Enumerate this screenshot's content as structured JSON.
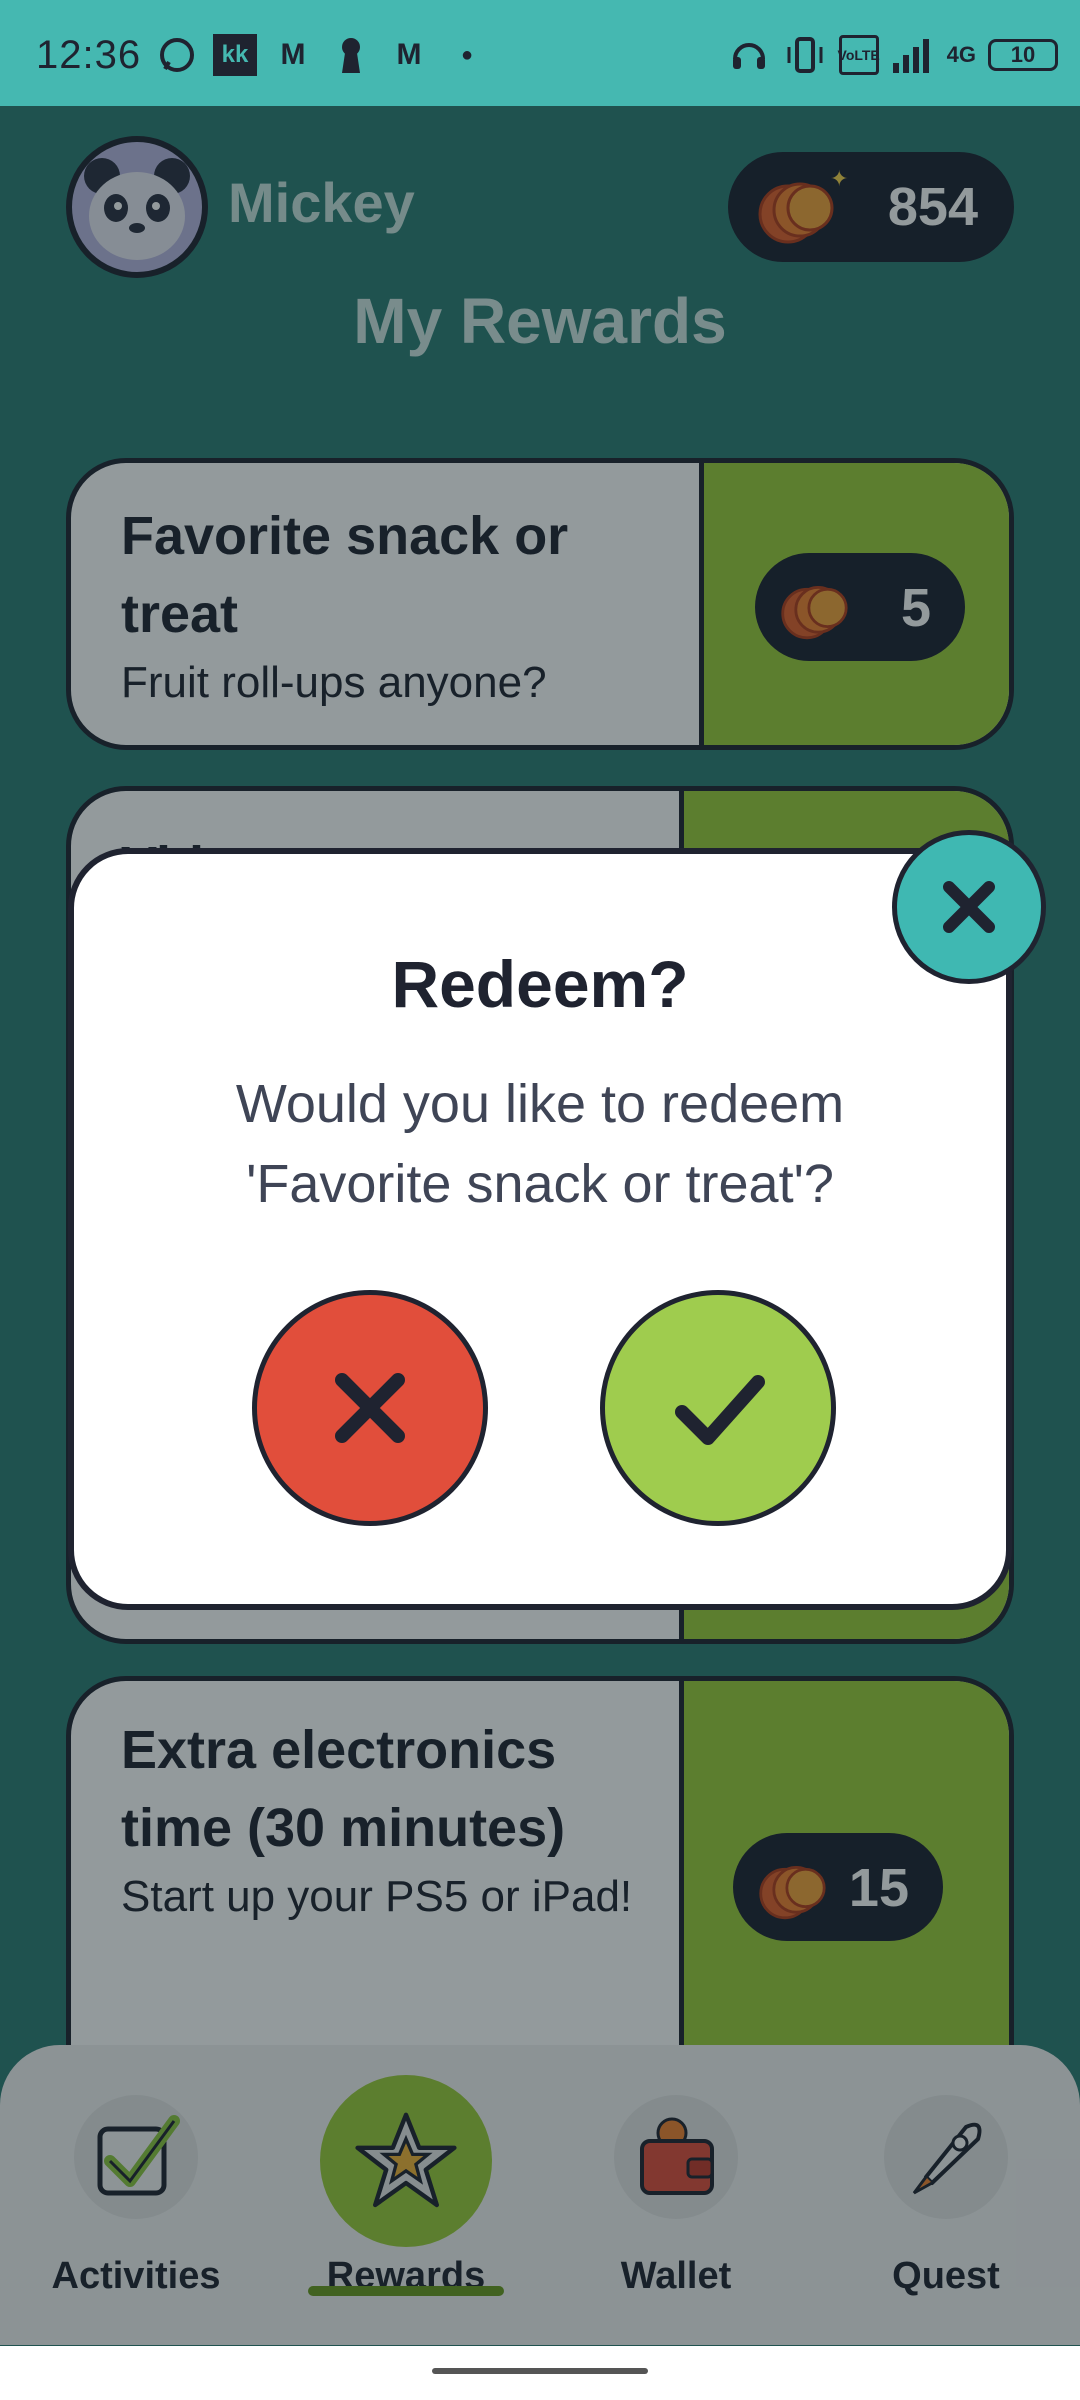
{
  "status_bar": {
    "time": "12:36",
    "network": "4G",
    "battery": "10",
    "icons_left": [
      "whatsapp-icon",
      "kk-app-icon",
      "gmail-icon",
      "keyhole-icon",
      "gmail-icon",
      "dot-icon"
    ],
    "icons_right": [
      "headset-icon",
      "vibrate-icon",
      "volte-icon",
      "signal-icon",
      "battery-icon"
    ]
  },
  "header": {
    "username": "Mickey",
    "coins": "854",
    "page_title": "My Rewards"
  },
  "rewards": [
    {
      "title": "Favorite snack or treat",
      "description": "Fruit roll-ups anyone?",
      "cost": "5"
    },
    {
      "title": "Vid",
      "description": "",
      "cost": ""
    },
    {
      "title": "Extra electronics time (30 minutes)",
      "description": "Start up your PS5 or iPad!",
      "cost": "15"
    }
  ],
  "modal": {
    "title": "Redeem?",
    "message": "Would you like to redeem 'Favorite snack or treat'?"
  },
  "nav": {
    "items": [
      {
        "label": "Activities",
        "icon": "checkbox-icon"
      },
      {
        "label": "Rewards",
        "icon": "star-icon",
        "active": true
      },
      {
        "label": "Wallet",
        "icon": "wallet-icon"
      },
      {
        "label": "Quest",
        "icon": "rocket-icon"
      }
    ]
  },
  "colors": {
    "status_bar": "#45b8b1",
    "dark": "#1f2330",
    "green": "#9ccc3a",
    "red": "#e14e3b",
    "teal": "#3fb8b2"
  }
}
